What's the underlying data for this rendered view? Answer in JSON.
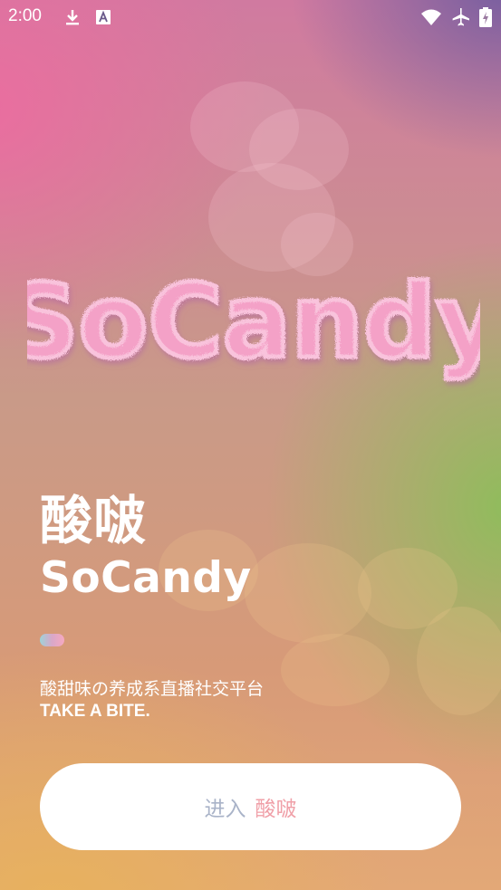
{
  "status_bar": {
    "time": "2:00",
    "icons": [
      "download-icon",
      "text-a-icon",
      "wifi-icon",
      "airplane-icon",
      "battery-charging-icon"
    ]
  },
  "logo": {
    "text": "SoCandy"
  },
  "hero": {
    "title_cn": "酸啵",
    "title_en": "SoCandy",
    "tagline": "酸甜味の养成系直播社交平台",
    "tagline_en": "TAKE A BITE."
  },
  "enter_button": {
    "label_a": "进入",
    "label_b": "酸啵"
  },
  "colors": {
    "button_bg": "#ffffff",
    "label_a": "#a9b3c8",
    "label_b": "#f0a0a8",
    "text": "#ffffff"
  }
}
